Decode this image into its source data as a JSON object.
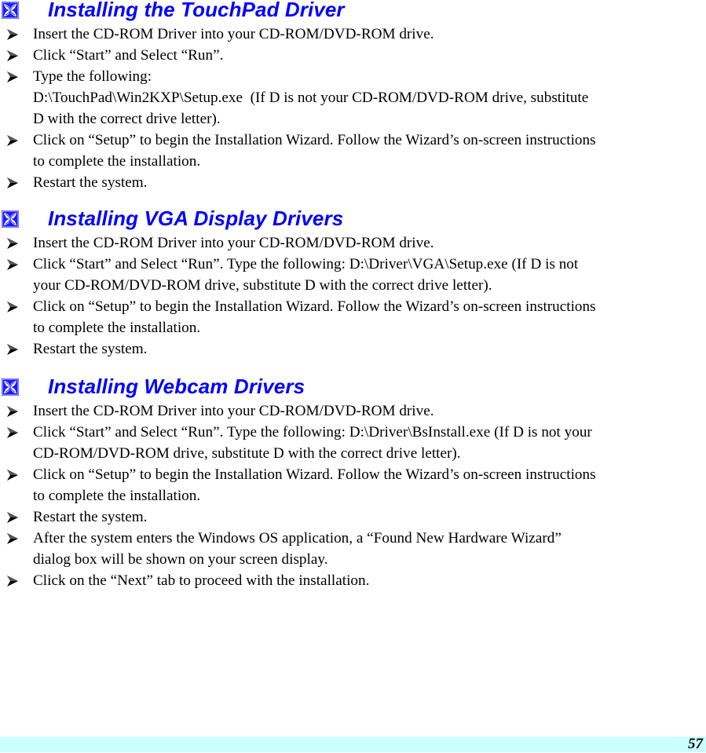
{
  "sections": [
    {
      "icon": "blue-ornament-icon",
      "title": "Installing the TouchPad Driver",
      "items": [
        {
          "lines": [
            "Insert the CD-ROM Driver into your CD-ROM/DVD-ROM drive."
          ]
        },
        {
          "lines": [
            "Click “Start” and Select “Run”."
          ]
        },
        {
          "lines": [
            "Type the following:",
            "D:\\TouchPad\\Win2KXP\\Setup.exe  (If D is not your CD-ROM/DVD-ROM drive, substitute",
            "D with the correct drive letter)."
          ]
        },
        {
          "lines": [
            "Click on “Setup” to begin the Installation Wizard. Follow the Wizard’s on-screen instructions",
            "to complete the installation."
          ]
        },
        {
          "lines": [
            "Restart the system."
          ]
        }
      ]
    },
    {
      "icon": "blue-ornament-icon",
      "title": "Installing VGA Display Drivers",
      "items": [
        {
          "lines": [
            "Insert the CD-ROM Driver into your CD-ROM/DVD-ROM drive."
          ]
        },
        {
          "lines": [
            "Click “Start” and Select “Run”. Type the following: D:\\Driver\\VGA\\Setup.exe (If D is not",
            "your CD-ROM/DVD-ROM drive, substitute D with the correct drive letter)."
          ]
        },
        {
          "lines": [
            "Click on “Setup” to begin the Installation Wizard. Follow the Wizard’s on-screen instructions",
            "to complete the installation."
          ]
        },
        {
          "lines": [
            "Restart the system."
          ]
        }
      ]
    },
    {
      "icon": "blue-ornament-icon",
      "title": "Installing Webcam Drivers",
      "items": [
        {
          "lines": [
            "Insert the CD-ROM Driver into your CD-ROM/DVD-ROM drive."
          ]
        },
        {
          "lines": [
            "Click “Start” and Select “Run”. Type the following: D:\\Driver\\BsInstall.exe (If D is not your",
            "CD-ROM/DVD-ROM drive, substitute D with the correct drive letter)."
          ]
        },
        {
          "lines": [
            "Click on “Setup” to begin the Installation Wizard. Follow the Wizard’s on-screen instructions",
            "to complete the installation."
          ]
        },
        {
          "lines": [
            "Restart the system."
          ]
        },
        {
          "lines": [
            "After the system enters the Windows OS application, a “Found New Hardware Wizard”",
            "dialog box will be shown on your screen display."
          ]
        },
        {
          "lines": [
            "Click on the “Next” tab to proceed with the installation."
          ]
        }
      ]
    }
  ],
  "footer": {
    "page_number": "57",
    "band_color": "#ccffff"
  },
  "colors": {
    "heading": "#0000ff",
    "icon_bg": "#1a1aff"
  }
}
